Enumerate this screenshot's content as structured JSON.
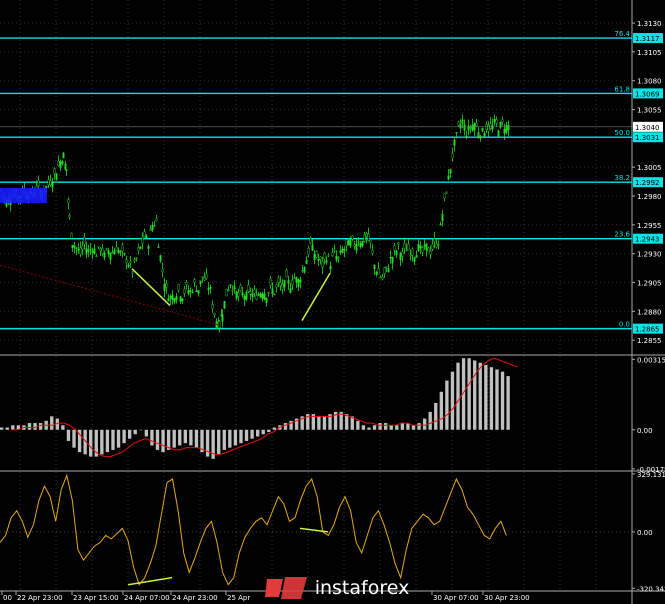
{
  "watermark": {
    "text": "instaforex"
  },
  "chart_data": {
    "type": "candlestick",
    "symbol": "GBPUSD",
    "price_ticks": [
      "1.3130",
      "1.3105",
      "1.3080",
      "1.3055",
      "1.3005",
      "1.2980",
      "1.2955",
      "1.2930",
      "1.2905",
      "1.2880",
      "1.2855"
    ],
    "price_range": [
      1.2843,
      1.315
    ],
    "current_price": "1.3040",
    "fibo_levels": [
      {
        "ratio": "76.4",
        "price": "1.3117"
      },
      {
        "ratio": "61.8",
        "price": "1.3069"
      },
      {
        "ratio": "50.0",
        "price": "1.3031"
      },
      {
        "ratio": "38.2",
        "price": "1.2992"
      },
      {
        "ratio": "23.6",
        "price": "1.2943"
      },
      {
        "ratio": "0.0",
        "price": "1.2865"
      }
    ],
    "x_labels": [
      "00",
      "22 Apr 23:00",
      "23 Apr 15:00",
      "24 Apr 07:00",
      "24 Apr 23:00",
      "25 Apr",
      "30 Apr 07:00",
      "30 Apr 23:00"
    ],
    "close_path": [
      [
        0,
        1.2985
      ],
      [
        6,
        1.2975
      ],
      [
        12,
        1.2983
      ],
      [
        18,
        1.2979
      ],
      [
        24,
        1.2986
      ],
      [
        30,
        1.298
      ],
      [
        36,
        1.2987
      ],
      [
        42,
        1.2983
      ],
      [
        48,
        1.299
      ],
      [
        54,
        1.2998
      ],
      [
        60,
        1.301
      ],
      [
        63,
        1.3015
      ],
      [
        66,
        1.3003
      ],
      [
        69,
        1.296
      ],
      [
        72,
        1.294
      ],
      [
        76,
        1.2935
      ],
      [
        80,
        1.293
      ],
      [
        84,
        1.2938
      ],
      [
        88,
        1.2932
      ],
      [
        92,
        1.2936
      ],
      [
        96,
        1.293
      ],
      [
        100,
        1.2935
      ],
      [
        104,
        1.2928
      ],
      [
        108,
        1.2933
      ],
      [
        112,
        1.2931
      ],
      [
        116,
        1.2936
      ],
      [
        120,
        1.293
      ],
      [
        124,
        1.2928
      ],
      [
        128,
        1.2922
      ],
      [
        132,
        1.2915
      ],
      [
        136,
        1.2925
      ],
      [
        140,
        1.2935
      ],
      [
        144,
        1.2945
      ],
      [
        148,
        1.294
      ],
      [
        152,
        1.2955
      ],
      [
        156,
        1.2958
      ],
      [
        158,
        1.294
      ],
      [
        162,
        1.2915
      ],
      [
        166,
        1.2898
      ],
      [
        170,
        1.2892
      ],
      [
        174,
        1.2895
      ],
      [
        178,
        1.2898
      ],
      [
        182,
        1.2894
      ],
      [
        186,
        1.29
      ],
      [
        190,
        1.2897
      ],
      [
        194,
        1.2903
      ],
      [
        198,
        1.2899
      ],
      [
        202,
        1.291
      ],
      [
        206,
        1.2905
      ],
      [
        210,
        1.2898
      ],
      [
        212,
        1.2885
      ],
      [
        214,
        1.2878
      ],
      [
        216,
        1.2872
      ],
      [
        219,
        1.2868
      ],
      [
        222,
        1.288
      ],
      [
        226,
        1.2895
      ],
      [
        230,
        1.2905
      ],
      [
        234,
        1.2898
      ],
      [
        238,
        1.2893
      ],
      [
        242,
        1.2895
      ],
      [
        246,
        1.2893
      ],
      [
        250,
        1.2896
      ],
      [
        254,
        1.2893
      ],
      [
        258,
        1.2895
      ],
      [
        262,
        1.2898
      ],
      [
        266,
        1.2895
      ],
      [
        270,
        1.29
      ],
      [
        274,
        1.2897
      ],
      [
        278,
        1.2903
      ],
      [
        282,
        1.29
      ],
      [
        286,
        1.2906
      ],
      [
        290,
        1.2903
      ],
      [
        294,
        1.2909
      ],
      [
        298,
        1.2906
      ],
      [
        302,
        1.2915
      ],
      [
        306,
        1.2925
      ],
      [
        310,
        1.2938
      ],
      [
        314,
        1.293
      ],
      [
        318,
        1.2925
      ],
      [
        322,
        1.292
      ],
      [
        326,
        1.2928
      ],
      [
        330,
        1.2922
      ],
      [
        334,
        1.293
      ],
      [
        338,
        1.2925
      ],
      [
        342,
        1.2933
      ],
      [
        346,
        1.2935
      ],
      [
        350,
        1.294
      ],
      [
        354,
        1.2938
      ],
      [
        358,
        1.2942
      ],
      [
        362,
        1.294
      ],
      [
        366,
        1.2945
      ],
      [
        370,
        1.2938
      ],
      [
        374,
        1.292
      ],
      [
        378,
        1.2912
      ],
      [
        382,
        1.2908
      ],
      [
        386,
        1.2915
      ],
      [
        390,
        1.2925
      ],
      [
        394,
        1.293
      ],
      [
        398,
        1.2935
      ],
      [
        402,
        1.2928
      ],
      [
        406,
        1.2935
      ],
      [
        410,
        1.2932
      ],
      [
        414,
        1.293
      ],
      [
        418,
        1.2935
      ],
      [
        422,
        1.2931
      ],
      [
        426,
        1.2936
      ],
      [
        430,
        1.2932
      ],
      [
        434,
        1.2938
      ],
      [
        438,
        1.294
      ],
      [
        442,
        1.2965
      ],
      [
        446,
        1.2985
      ],
      [
        450,
        1.3005
      ],
      [
        454,
        1.3025
      ],
      [
        458,
        1.3038
      ],
      [
        462,
        1.3045
      ],
      [
        466,
        1.3035
      ],
      [
        470,
        1.304
      ],
      [
        474,
        1.3043
      ],
      [
        478,
        1.3037
      ],
      [
        482,
        1.3035
      ],
      [
        486,
        1.304
      ],
      [
        490,
        1.3037
      ],
      [
        494,
        1.3043
      ],
      [
        498,
        1.304
      ],
      [
        502,
        1.3042
      ],
      [
        506,
        1.304
      ],
      [
        510,
        1.3041
      ]
    ],
    "macd": {
      "ticks": [
        "0.00315",
        "0.00",
        "-0.00175"
      ],
      "range": [
        -0.0018,
        0.0033
      ],
      "histogram_series": [
        0.0001,
        0.0001,
        0.0002,
        0.0002,
        0.0002,
        0.0003,
        0.0003,
        0.0003,
        0.0004,
        0.0006,
        0.0005,
        0.0002,
        -0.0005,
        -0.0008,
        -0.001,
        -0.0011,
        -0.0012,
        -0.0012,
        -0.0011,
        -0.001,
        -0.0009,
        -0.0008,
        -0.0006,
        -0.0004,
        -0.0002,
        0.0,
        -0.0003,
        -0.0007,
        -0.0009,
        -0.001,
        -0.0009,
        -0.0008,
        -0.0007,
        -0.0006,
        -0.0007,
        -0.0008,
        -0.001,
        -0.0012,
        -0.0013,
        -0.0011,
        -0.0009,
        -0.0008,
        -0.0007,
        -0.0006,
        -0.0005,
        -0.0004,
        -0.0003,
        -0.0002,
        -0.0001,
        0.0001,
        0.0002,
        0.0003,
        0.0004,
        0.0005,
        0.0006,
        0.0007,
        0.0007,
        0.0006,
        0.0006,
        0.0007,
        0.0008,
        0.0008,
        0.0007,
        0.0006,
        0.0004,
        0.0002,
        0.0001,
        0.0002,
        0.0003,
        0.0003,
        0.0002,
        0.0002,
        0.0003,
        0.0003,
        0.0002,
        0.0003,
        0.0005,
        0.0008,
        0.0012,
        0.0017,
        0.0022,
        0.0026,
        0.003,
        0.0032,
        0.0032,
        0.0031,
        0.003,
        0.0029,
        0.0028,
        0.0027,
        0.0026,
        0.0024
      ],
      "signal_series": [
        0.0,
        0.0,
        0.0001,
        0.0001,
        0.0001,
        0.0002,
        0.0002,
        0.0002,
        0.0003,
        0.0003,
        0.0002,
        0.0,
        -0.0003,
        -0.0006,
        -0.0009,
        -0.0011,
        -0.0012,
        -0.0012,
        -0.0011,
        -0.001,
        -0.0008,
        -0.0006,
        -0.0005,
        -0.0004,
        -0.0005,
        -0.0006,
        -0.0007,
        -0.0008,
        -0.0009,
        -0.0009,
        -0.0008,
        -0.0008,
        -0.0008,
        -0.0009,
        -0.001,
        -0.0011,
        -0.0011,
        -0.001,
        -0.0009,
        -0.0008,
        -0.0007,
        -0.0006,
        -0.0005,
        -0.0004,
        -0.0002,
        -0.0001,
        0.0001,
        0.0002,
        0.0003,
        0.0004,
        0.0005,
        0.0006,
        0.0006,
        0.0006,
        0.0006,
        0.0006,
        0.0007,
        0.0007,
        0.0006,
        0.0005,
        0.0004,
        0.0003,
        0.0003,
        0.0002,
        0.0002,
        0.0002,
        0.0002,
        0.0003,
        0.0003,
        0.0002,
        0.0002,
        0.0002,
        0.0003,
        0.0004,
        0.0005,
        0.0007,
        0.001,
        0.0014,
        0.0018,
        0.0022,
        0.0026,
        0.0029,
        0.0031,
        0.0032,
        0.0031,
        0.003,
        0.0029,
        0.0028
      ]
    },
    "oscillator": {
      "ticks": [
        "329.1319",
        "0.00",
        "-320.342"
      ],
      "range": [
        -330,
        340
      ],
      "series": [
        -60,
        -20,
        80,
        120,
        60,
        -30,
        40,
        180,
        260,
        200,
        60,
        240,
        320,
        180,
        -100,
        -160,
        -120,
        -80,
        -60,
        -20,
        -40,
        -10,
        20,
        -50,
        -200,
        -300,
        -260,
        -180,
        -80,
        100,
        280,
        300,
        120,
        -120,
        -230,
        -150,
        -60,
        20,
        60,
        -60,
        -230,
        -300,
        -260,
        -120,
        -30,
        20,
        60,
        80,
        40,
        120,
        200,
        160,
        60,
        80,
        180,
        260,
        300,
        200,
        0,
        -20,
        40,
        140,
        200,
        120,
        -60,
        -120,
        -20,
        80,
        120,
        40,
        -60,
        -180,
        -260,
        -100,
        20,
        60,
        100,
        80,
        40,
        60,
        140,
        220,
        300,
        240,
        140,
        100,
        40,
        -20,
        -40,
        20,
        60,
        -20
      ]
    }
  }
}
